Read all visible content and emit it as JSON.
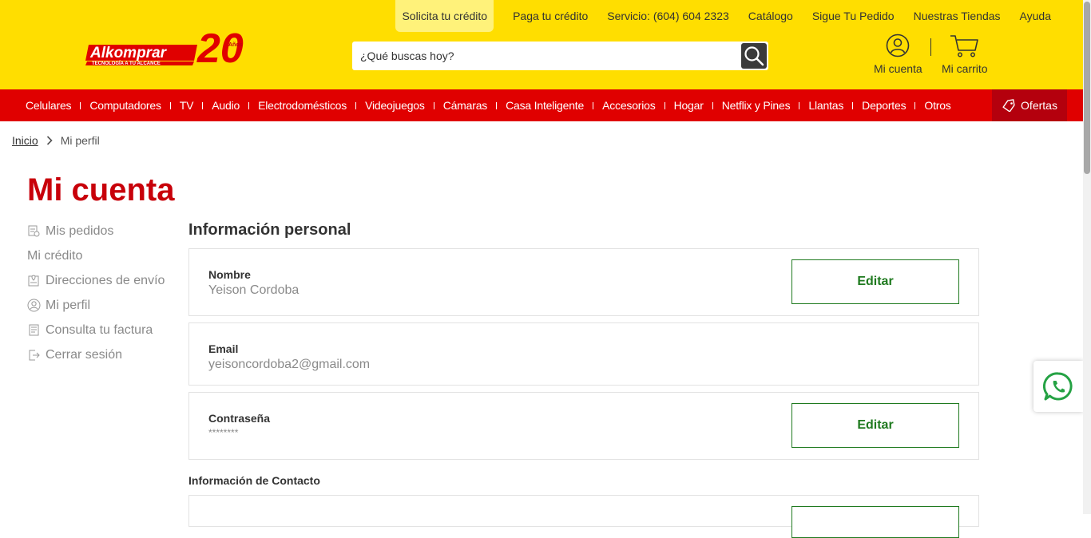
{
  "brand": {
    "logo_text": "Alkomprar",
    "logo_tagline": "TECNOLOGÍA A TU ALCANCE",
    "anniversary": "20",
    "anniversary_label": "Años"
  },
  "top_links": [
    {
      "label": "Solicita tu crédito"
    },
    {
      "label": "Paga tu crédito"
    },
    {
      "label": "Servicio: (604) 604 2323"
    },
    {
      "label": "Catálogo"
    },
    {
      "label": "Sigue Tu Pedido"
    },
    {
      "label": "Nuestras Tiendas"
    },
    {
      "label": "Ayuda"
    }
  ],
  "search": {
    "placeholder": "¿Qué buscas hoy?"
  },
  "header_actions": {
    "account": "Mi cuenta",
    "cart": "Mi carrito"
  },
  "nav": {
    "items": [
      "Celulares",
      "Computadores",
      "TV",
      "Audio",
      "Electrodomésticos",
      "Videojuegos",
      "Cámaras",
      "Casa Inteligente",
      "Accesorios",
      "Hogar",
      "Netflix y Pines",
      "Llantas",
      "Deportes",
      "Otros"
    ],
    "offers": "Ofertas"
  },
  "breadcrumb": {
    "home": "Inicio",
    "current": "Mi perfil"
  },
  "page_title": "Mi cuenta",
  "sidebar": [
    {
      "label": "Mis pedidos",
      "icon": "orders-icon"
    },
    {
      "label": "Mi crédito",
      "icon": ""
    },
    {
      "label": "Direcciones de envío",
      "icon": "address-icon"
    },
    {
      "label": "Mi perfil",
      "icon": "profile-icon"
    },
    {
      "label": "Consulta tu factura",
      "icon": "invoice-icon"
    },
    {
      "label": "Cerrar sesión",
      "icon": "logout-icon"
    }
  ],
  "personal_info": {
    "title": "Información personal",
    "name": {
      "label": "Nombre",
      "value": "Yeison Cordoba",
      "button": "Editar"
    },
    "email": {
      "label": "Email",
      "value": "yeisoncordoba2@gmail.com"
    },
    "password": {
      "label": "Contraseña",
      "value": "********",
      "button": "Editar"
    }
  },
  "contact_info": {
    "title": "Información de Contacto"
  },
  "colors": {
    "header_yellow": "#ffde00",
    "nav_red": "#e00000",
    "title_red": "#c8000a",
    "edit_green": "#1f7a1f",
    "offers_bg": "#b4000d"
  }
}
